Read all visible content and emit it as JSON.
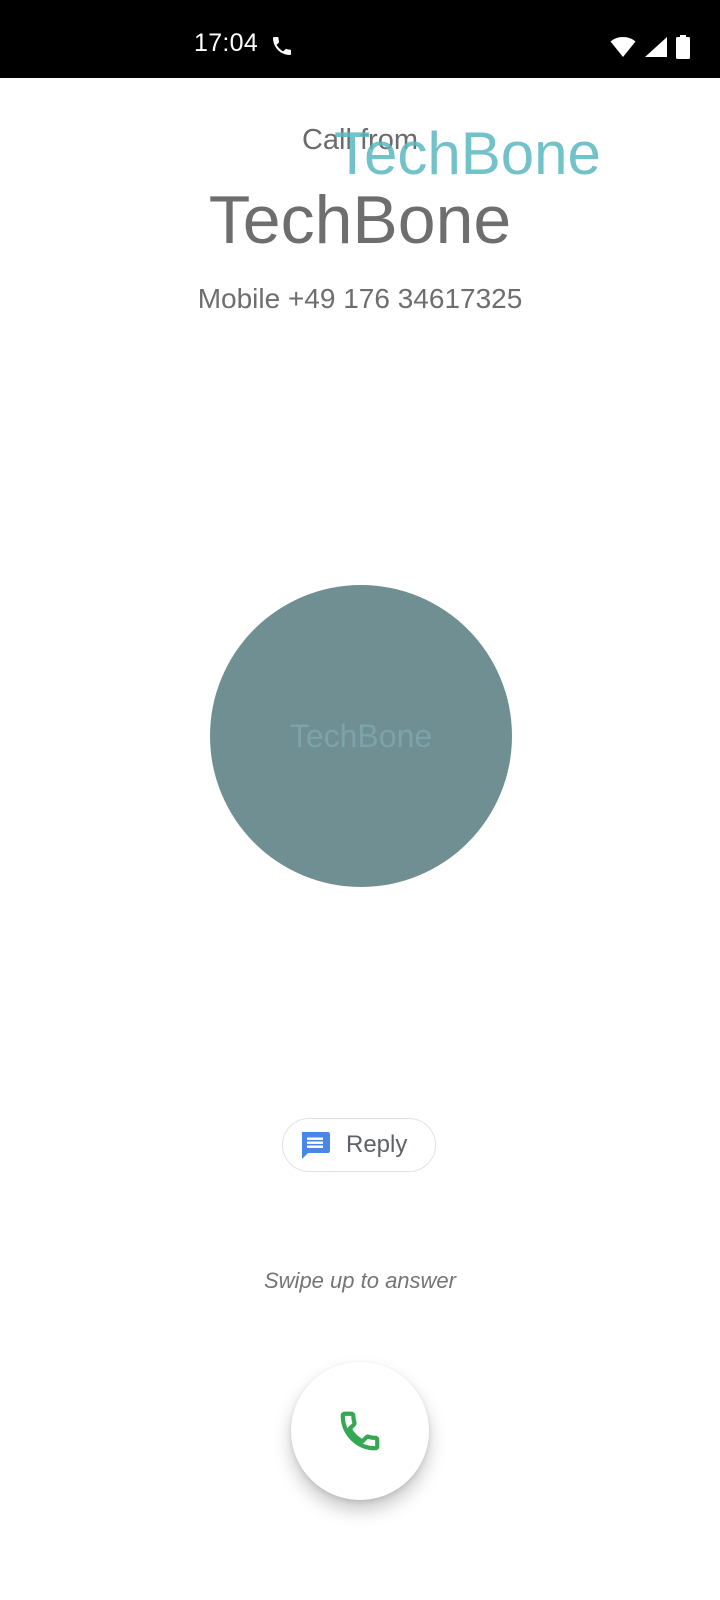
{
  "status_bar": {
    "time": "17:04",
    "icons": [
      "call-icon",
      "wifi-icon",
      "signal-icon",
      "battery-icon"
    ]
  },
  "watermark": {
    "text": "TechBone",
    "color": "#5bb8c1"
  },
  "incoming_call": {
    "label": "Call from",
    "caller_name": "TechBone",
    "number_line": "Mobile +49 176 34617325",
    "avatar_color": "#6f8f93",
    "avatar_watermark": "TechBone"
  },
  "actions": {
    "reply_label": "Reply",
    "reply_icon": "message-icon",
    "swipe_hint": "Swipe up to answer",
    "answer_icon": "phone-answer-icon",
    "answer_color": "#34a853"
  }
}
